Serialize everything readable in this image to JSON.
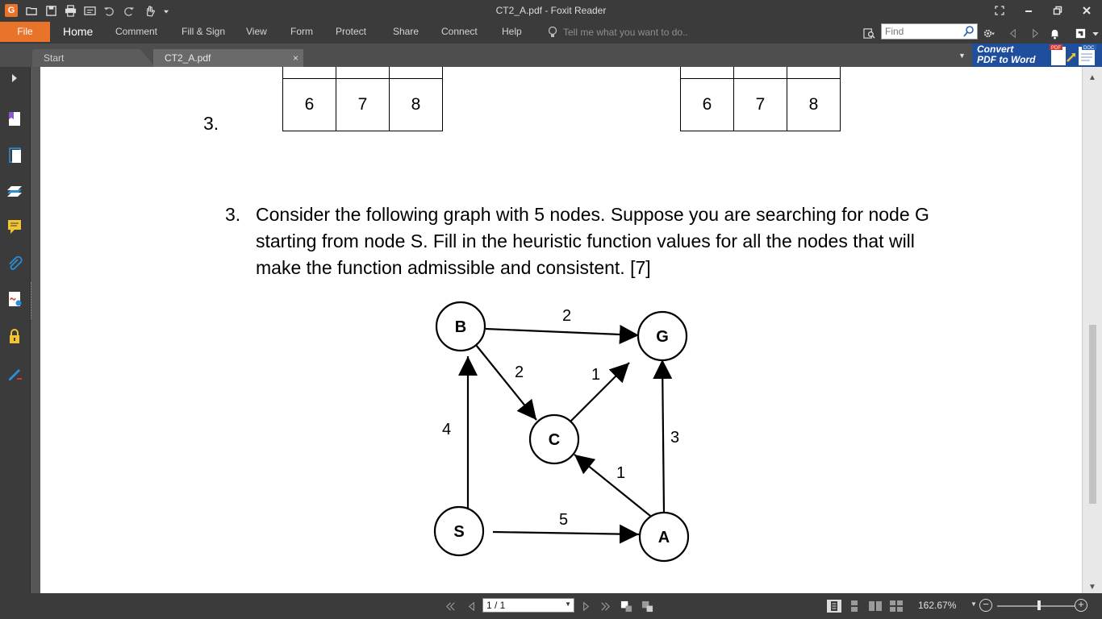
{
  "window": {
    "title": "CT2_A.pdf - Foxit Reader",
    "app_logo": "G"
  },
  "ribbon": {
    "file_label": "File",
    "tabs": [
      "Home",
      "Comment",
      "Fill & Sign",
      "View",
      "Form",
      "Protect",
      "Share",
      "Connect",
      "Help"
    ],
    "tell_me_placeholder": "Tell me what you want to do..",
    "find_placeholder": "Find"
  },
  "doc_tabs": {
    "start_label": "Start",
    "current_label": "CT2_A.pdf",
    "close_symbol": "×"
  },
  "convert_banner": {
    "line1": "Convert",
    "line2": "PDF to Word",
    "badge_pdf": "PDF",
    "badge_doc": "DOC"
  },
  "document": {
    "table_values": [
      "6",
      "7",
      "8"
    ],
    "stray_number": "3.",
    "question_number": "3.",
    "question_text": "Consider the following graph with 5 nodes. Suppose you are searching for node G starting from node S. Fill in the heuristic function values for all the nodes that will make the function admissible and consistent. [7]",
    "graph": {
      "nodes": [
        "B",
        "G",
        "C",
        "S",
        "A"
      ],
      "edges": [
        {
          "from": "B",
          "to": "G",
          "weight": "2"
        },
        {
          "from": "B",
          "to": "C",
          "weight": "2"
        },
        {
          "from": "C",
          "to": "G",
          "weight": "1"
        },
        {
          "from": "S",
          "to": "B",
          "weight": "4"
        },
        {
          "from": "A",
          "to": "G",
          "weight": "3"
        },
        {
          "from": "A",
          "to": "C",
          "weight": "1"
        },
        {
          "from": "S",
          "to": "A",
          "weight": "5"
        }
      ]
    }
  },
  "statusbar": {
    "page_value": "1 / 1",
    "zoom": "162.67%"
  },
  "colors": {
    "accent_orange": "#e8742a",
    "convert_blue": "#1f4e9c",
    "chrome_dark": "#3b3b3b"
  }
}
